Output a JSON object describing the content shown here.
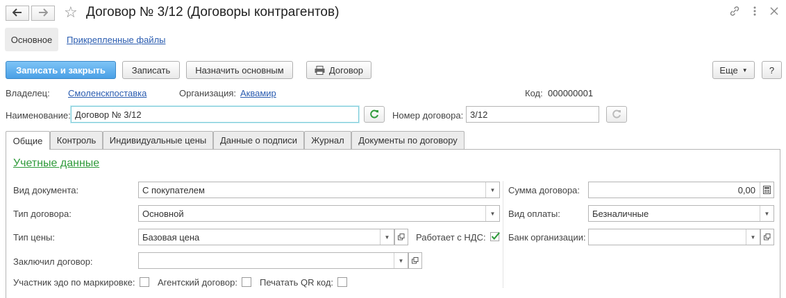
{
  "window": {
    "title": "Договор № 3/12 (Договоры контрагентов)"
  },
  "sections": {
    "main": "Основное",
    "files": "Прикрепленные файлы"
  },
  "toolbar": {
    "save_close": "Записать и закрыть",
    "save": "Записать",
    "set_default": "Назначить основным",
    "contract": "Договор",
    "more": "Еще",
    "help": "?"
  },
  "header": {
    "owner_label": "Владелец:",
    "owner_value": "Смоленскпоставка",
    "org_label": "Организация:",
    "org_value": "Аквамир",
    "code_label": "Код:",
    "code_value": "000000001",
    "name_label": "Наименование:",
    "name_value": "Договор № 3/12",
    "number_label": "Номер договора:",
    "number_value": "3/12"
  },
  "tabs": [
    {
      "label": "Общие"
    },
    {
      "label": "Контроль"
    },
    {
      "label": "Индивидуальные цены"
    },
    {
      "label": "Данные о подписи"
    },
    {
      "label": "Журнал"
    },
    {
      "label": "Документы по договору"
    }
  ],
  "general": {
    "group_title": "Учетные данные",
    "doc_kind_label": "Вид документа:",
    "doc_kind_value": "С покупателем",
    "contract_type_label": "Тип договора:",
    "contract_type_value": "Основной",
    "price_type_label": "Тип цены:",
    "price_type_value": "Базовая цена",
    "vat_label": "Работает с НДС:",
    "vat_checked": true,
    "concluded_label": "Заключил договор:",
    "concluded_value": "",
    "edo_label": "Участник эдо по маркировке:",
    "agent_label": "Агентский договор:",
    "qr_label": "Печатать QR код:",
    "amount_label": "Сумма договора:",
    "amount_value": "0,00",
    "payment_label": "Вид оплаты:",
    "payment_value": "Безналичные",
    "bank_label": "Банк организации:",
    "bank_value": ""
  },
  "colors": {
    "primary": "#4aa0e6",
    "group_title": "#2e9a3a",
    "link": "#2a5cb0",
    "check": "#2e9a3a"
  }
}
